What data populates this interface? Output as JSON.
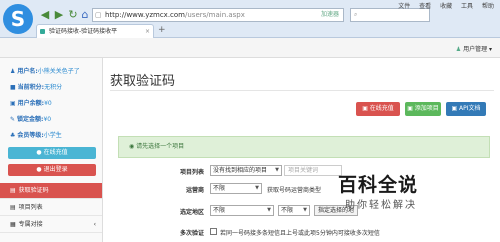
{
  "browser": {
    "url_host": "http://www.yzmcx.com",
    "url_path": "/users/main.aspx",
    "speed_label": "加速器",
    "search_placeholder": "",
    "menu": [
      "文件",
      "查看",
      "收藏",
      "工具",
      "帮助"
    ],
    "tab_title": "验证码接收-验证码接收平",
    "new_tab": "+"
  },
  "header": {
    "user_menu": "用户管理"
  },
  "sidebar": {
    "info": [
      {
        "k": "用户名:",
        "v": "小熊关关色子了"
      },
      {
        "k": "当前积分:",
        "v": "无积分"
      },
      {
        "k": "用户余额:",
        "v": "¥0"
      },
      {
        "k": "锁定金额:",
        "v": "¥0"
      },
      {
        "k": "会员等级:",
        "v": "小学生"
      }
    ],
    "online_recharge": "在线充值",
    "logout": "退出登录",
    "nav": [
      {
        "label": "获取验证码",
        "active": true
      },
      {
        "label": "项目列表",
        "active": false
      },
      {
        "label": "专属对接",
        "active": false
      }
    ]
  },
  "main": {
    "title": "获取验证码",
    "actions": {
      "recharge": "在线充值",
      "add_project": "添加项目",
      "api_docs": "API文档"
    },
    "alert": "请先选择一个项目",
    "form": {
      "project_label": "项目列表",
      "project_select": "没有找到相应的项目",
      "project_search_placeholder": "项目关键词",
      "carrier_label": "运营商",
      "carrier_select": "不限",
      "carrier_hint": "获取号码运营商类型",
      "region_label": "选定地区",
      "region_select1": "不限",
      "region_select2": "不限",
      "region_button": "指定选择的地",
      "multi_label": "多次验证",
      "multi_text": "若同一号码接多条短信且上号或此项5分钟内可接收多次短信"
    }
  },
  "watermark": {
    "logo": "百科",
    "title": "百科全说",
    "subtitle": "助你轻松解决"
  }
}
